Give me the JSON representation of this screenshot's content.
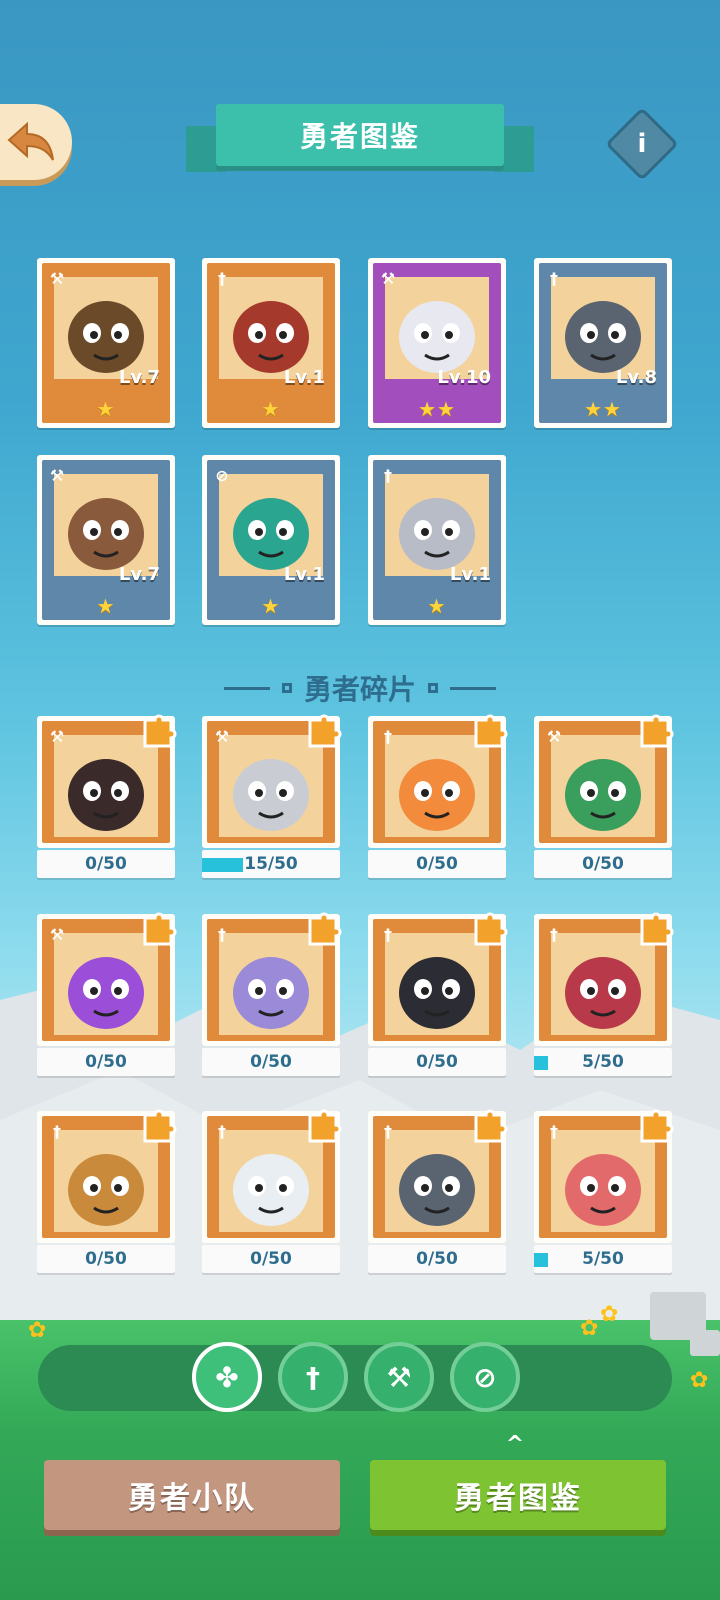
{
  "header": {
    "title": "勇者图鉴",
    "info_glyph": "i",
    "back_icon": "back-arrow"
  },
  "heroes": [
    {
      "level": "Lv.7",
      "stars": "★",
      "color": "orange",
      "role": "hammer",
      "accent": "#6b4a2a"
    },
    {
      "level": "Lv.1",
      "stars": "★",
      "color": "orange",
      "role": "sword",
      "accent": "#a53a2c"
    },
    {
      "level": "Lv.10",
      "stars": "★★",
      "color": "purple",
      "role": "hammer",
      "accent": "#e8e8f0"
    },
    {
      "level": "Lv.8",
      "stars": "★★",
      "color": "blue",
      "role": "sword",
      "accent": "#5a6470"
    },
    {
      "level": "Lv.7",
      "stars": "★",
      "color": "blue",
      "role": "hammer",
      "accent": "#8a5a3c"
    },
    {
      "level": "Lv.1",
      "stars": "★",
      "color": "blue",
      "role": "compass",
      "accent": "#2aa58f"
    },
    {
      "level": "Lv.1",
      "stars": "★",
      "color": "blue",
      "role": "sword",
      "accent": "#b8bcc6"
    }
  ],
  "shards_section": {
    "title": "勇者碎片"
  },
  "shards": [
    {
      "count": "0/50",
      "progress": 0,
      "role": "hammer",
      "accent": "#3a2a2a"
    },
    {
      "count": "15/50",
      "progress": 0.3,
      "role": "hammer",
      "accent": "#c9ccd2"
    },
    {
      "count": "0/50",
      "progress": 0,
      "role": "sword",
      "accent": "#f28b3c"
    },
    {
      "count": "0/50",
      "progress": 0,
      "role": "hammer",
      "accent": "#3a9e5c"
    },
    {
      "count": "0/50",
      "progress": 0,
      "role": "hammer",
      "accent": "#9b4fd8"
    },
    {
      "count": "0/50",
      "progress": 0,
      "role": "sword",
      "accent": "#9a8ad8"
    },
    {
      "count": "0/50",
      "progress": 0,
      "role": "sword",
      "accent": "#2c2c34"
    },
    {
      "count": "5/50",
      "progress": 0.1,
      "role": "sword",
      "accent": "#b83a4a"
    },
    {
      "count": "0/50",
      "progress": 0,
      "role": "sword",
      "accent": "#c98a3c"
    },
    {
      "count": "0/50",
      "progress": 0,
      "role": "sword",
      "accent": "#e8eef2"
    },
    {
      "count": "0/50",
      "progress": 0,
      "role": "sword",
      "accent": "#5a6470"
    },
    {
      "count": "5/50",
      "progress": 0.1,
      "role": "sword",
      "accent": "#e36a6a"
    }
  ],
  "filters": [
    {
      "icon": "all-icon",
      "glyph": "✤",
      "selected": true
    },
    {
      "icon": "sword-icon",
      "glyph": "†",
      "selected": false
    },
    {
      "icon": "hammer-icon",
      "glyph": "⚒",
      "selected": false
    },
    {
      "icon": "compass-icon",
      "glyph": "⊘",
      "selected": false
    }
  ],
  "bottom": {
    "team_label": "勇者小队",
    "atlas_label": "勇者图鉴",
    "caret": "^"
  }
}
